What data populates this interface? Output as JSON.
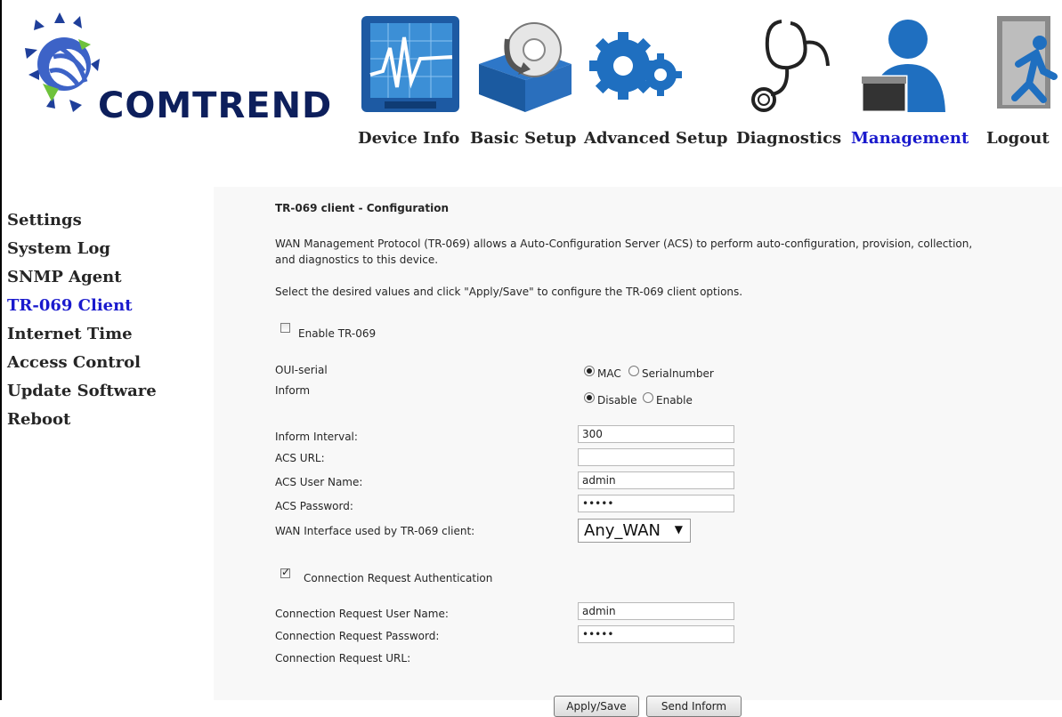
{
  "brand": {
    "logo_text": "COMTREND"
  },
  "nav": [
    {
      "label": "Device Info",
      "icon": "monitor-chart-icon"
    },
    {
      "label": "Basic Setup",
      "icon": "box-disc-icon"
    },
    {
      "label": "Advanced Setup",
      "icon": "gears-icon"
    },
    {
      "label": "Diagnostics",
      "icon": "stethoscope-icon"
    },
    {
      "label": "Management",
      "icon": "user-card-icon",
      "active": true
    },
    {
      "label": "Logout",
      "icon": "exit-door-icon"
    }
  ],
  "sidebar": [
    {
      "label": "Settings"
    },
    {
      "label": "System Log"
    },
    {
      "label": "SNMP Agent"
    },
    {
      "label": "TR-069 Client",
      "active": true
    },
    {
      "label": "Internet Time"
    },
    {
      "label": "Access Control"
    },
    {
      "label": "Update Software"
    },
    {
      "label": "Reboot"
    }
  ],
  "page": {
    "title": "TR-069 client - Configuration",
    "description_line1": "WAN Management Protocol (TR-069) allows a Auto-Configuration Server (ACS) to perform auto-configuration, provision, collection,",
    "description_line2": "and diagnostics to this device.",
    "instruction": "Select the desired values and click \"Apply/Save\" to configure the TR-069 client options."
  },
  "form": {
    "enable_tr069_label": "Enable TR-069",
    "enable_tr069_checked": false,
    "oui_serial_label": "OUI-serial",
    "oui_mac_label": "MAC",
    "oui_serialnumber_label": "Serialnumber",
    "inform_label": "Inform",
    "inform_disable_label": "Disable",
    "inform_enable_label": "Enable",
    "inform_interval_label": "Inform Interval:",
    "inform_interval_value": "300",
    "acs_url_label": "ACS URL:",
    "acs_url_value": "",
    "acs_user_label": "ACS User Name:",
    "acs_user_value": "admin",
    "acs_password_label": "ACS Password:",
    "acs_password_value": "•••••",
    "wan_interface_label": "WAN Interface used by TR-069 client:",
    "wan_interface_value": "Any_WAN",
    "conn_req_auth_label": "Connection Request Authentication",
    "conn_req_auth_checked": true,
    "conn_req_user_label": "Connection Request User Name:",
    "conn_req_user_value": "admin",
    "conn_req_password_label": "Connection Request Password:",
    "conn_req_password_value": "•••••",
    "conn_req_url_label": "Connection Request URL:"
  },
  "buttons": {
    "apply_save": "Apply/Save",
    "send_inform": "Send Inform"
  },
  "colors": {
    "active_link": "#1a1acd",
    "brand_blue": "#0d1f5c",
    "content_bg": "#f8f8f8"
  }
}
